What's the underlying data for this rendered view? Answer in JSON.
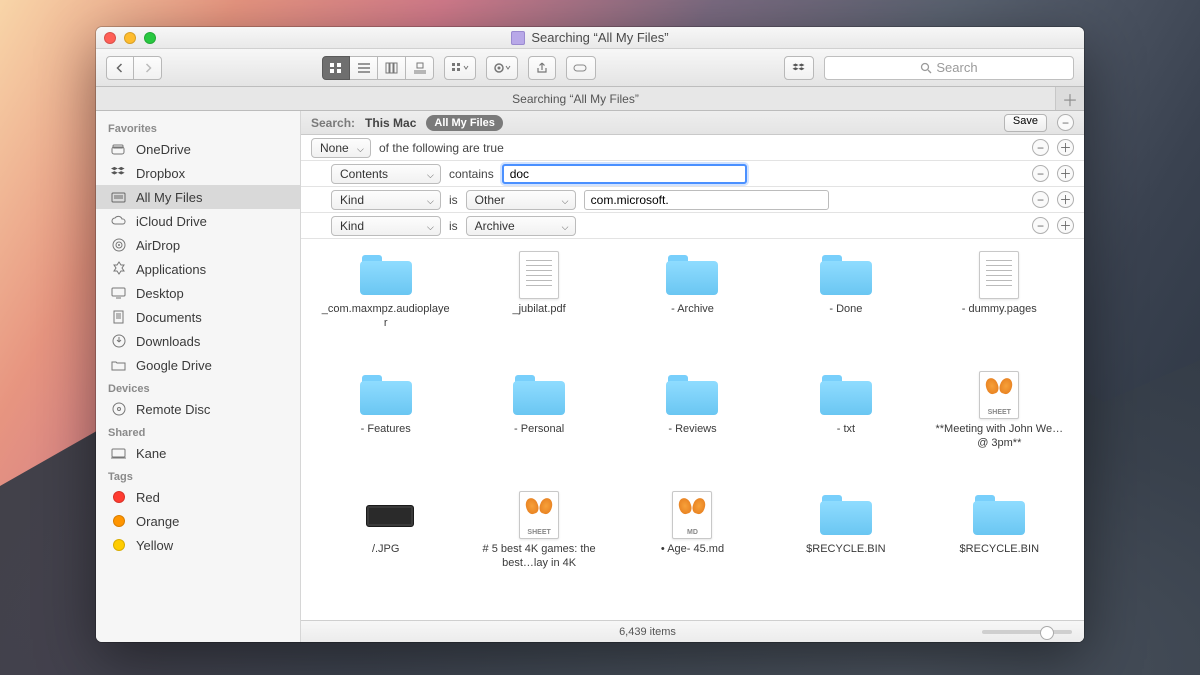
{
  "window": {
    "title": "Searching “All My Files”"
  },
  "toolbar": {
    "search_placeholder": "Search"
  },
  "tabbar": {
    "tab_label": "Searching “All My Files”"
  },
  "sidebar": {
    "sections": {
      "favorites": "Favorites",
      "devices": "Devices",
      "shared": "Shared",
      "tags": "Tags"
    },
    "favorites": [
      "OneDrive",
      "Dropbox",
      "All My Files",
      "iCloud Drive",
      "AirDrop",
      "Applications",
      "Desktop",
      "Documents",
      "Downloads",
      "Google Drive"
    ],
    "devices": [
      "Remote Disc"
    ],
    "shared": [
      "Kane"
    ],
    "tags": [
      "Red",
      "Orange",
      "Yellow"
    ],
    "tag_colors": [
      "#ff3b30",
      "#ff9500",
      "#ffcc00"
    ]
  },
  "scopebar": {
    "label": "Search:",
    "this_mac": "This Mac",
    "all_my_files": "All My Files",
    "save": "Save"
  },
  "criteria": {
    "row0": {
      "left": "None",
      "text": "of the following are true"
    },
    "row1": {
      "left": "Contents",
      "op": "contains",
      "value": "doc"
    },
    "row2": {
      "left": "Kind",
      "op": "is",
      "right": "Other",
      "value": "com.microsoft."
    },
    "row3": {
      "left": "Kind",
      "op": "is",
      "right": "Archive"
    }
  },
  "results": [
    {
      "name": "_com.maxmpz.audioplayer",
      "type": "folder"
    },
    {
      "name": "_jubilat.pdf",
      "type": "doclines"
    },
    {
      "name": "- Archive",
      "type": "folder"
    },
    {
      "name": "- Done",
      "type": "folder"
    },
    {
      "name": "- dummy.pages",
      "type": "doclines"
    },
    {
      "name": "- Features",
      "type": "folder"
    },
    {
      "name": "- Personal",
      "type": "folder"
    },
    {
      "name": "- Reviews",
      "type": "folder"
    },
    {
      "name": "- txt",
      "type": "folder"
    },
    {
      "name": "**Meeting with John We…@ 3pm**",
      "type": "sheet"
    },
    {
      "name": "/.JPG",
      "type": "keyboard"
    },
    {
      "name": "# 5 best 4K games: the best…lay in 4K",
      "type": "sheet"
    },
    {
      "name": "• Age- 45.md",
      "type": "md"
    },
    {
      "name": "$RECYCLE.BIN",
      "type": "folder"
    },
    {
      "name": "$RECYCLE.BIN",
      "type": "folder"
    }
  ],
  "statusbar": {
    "count": "6,439 items"
  }
}
